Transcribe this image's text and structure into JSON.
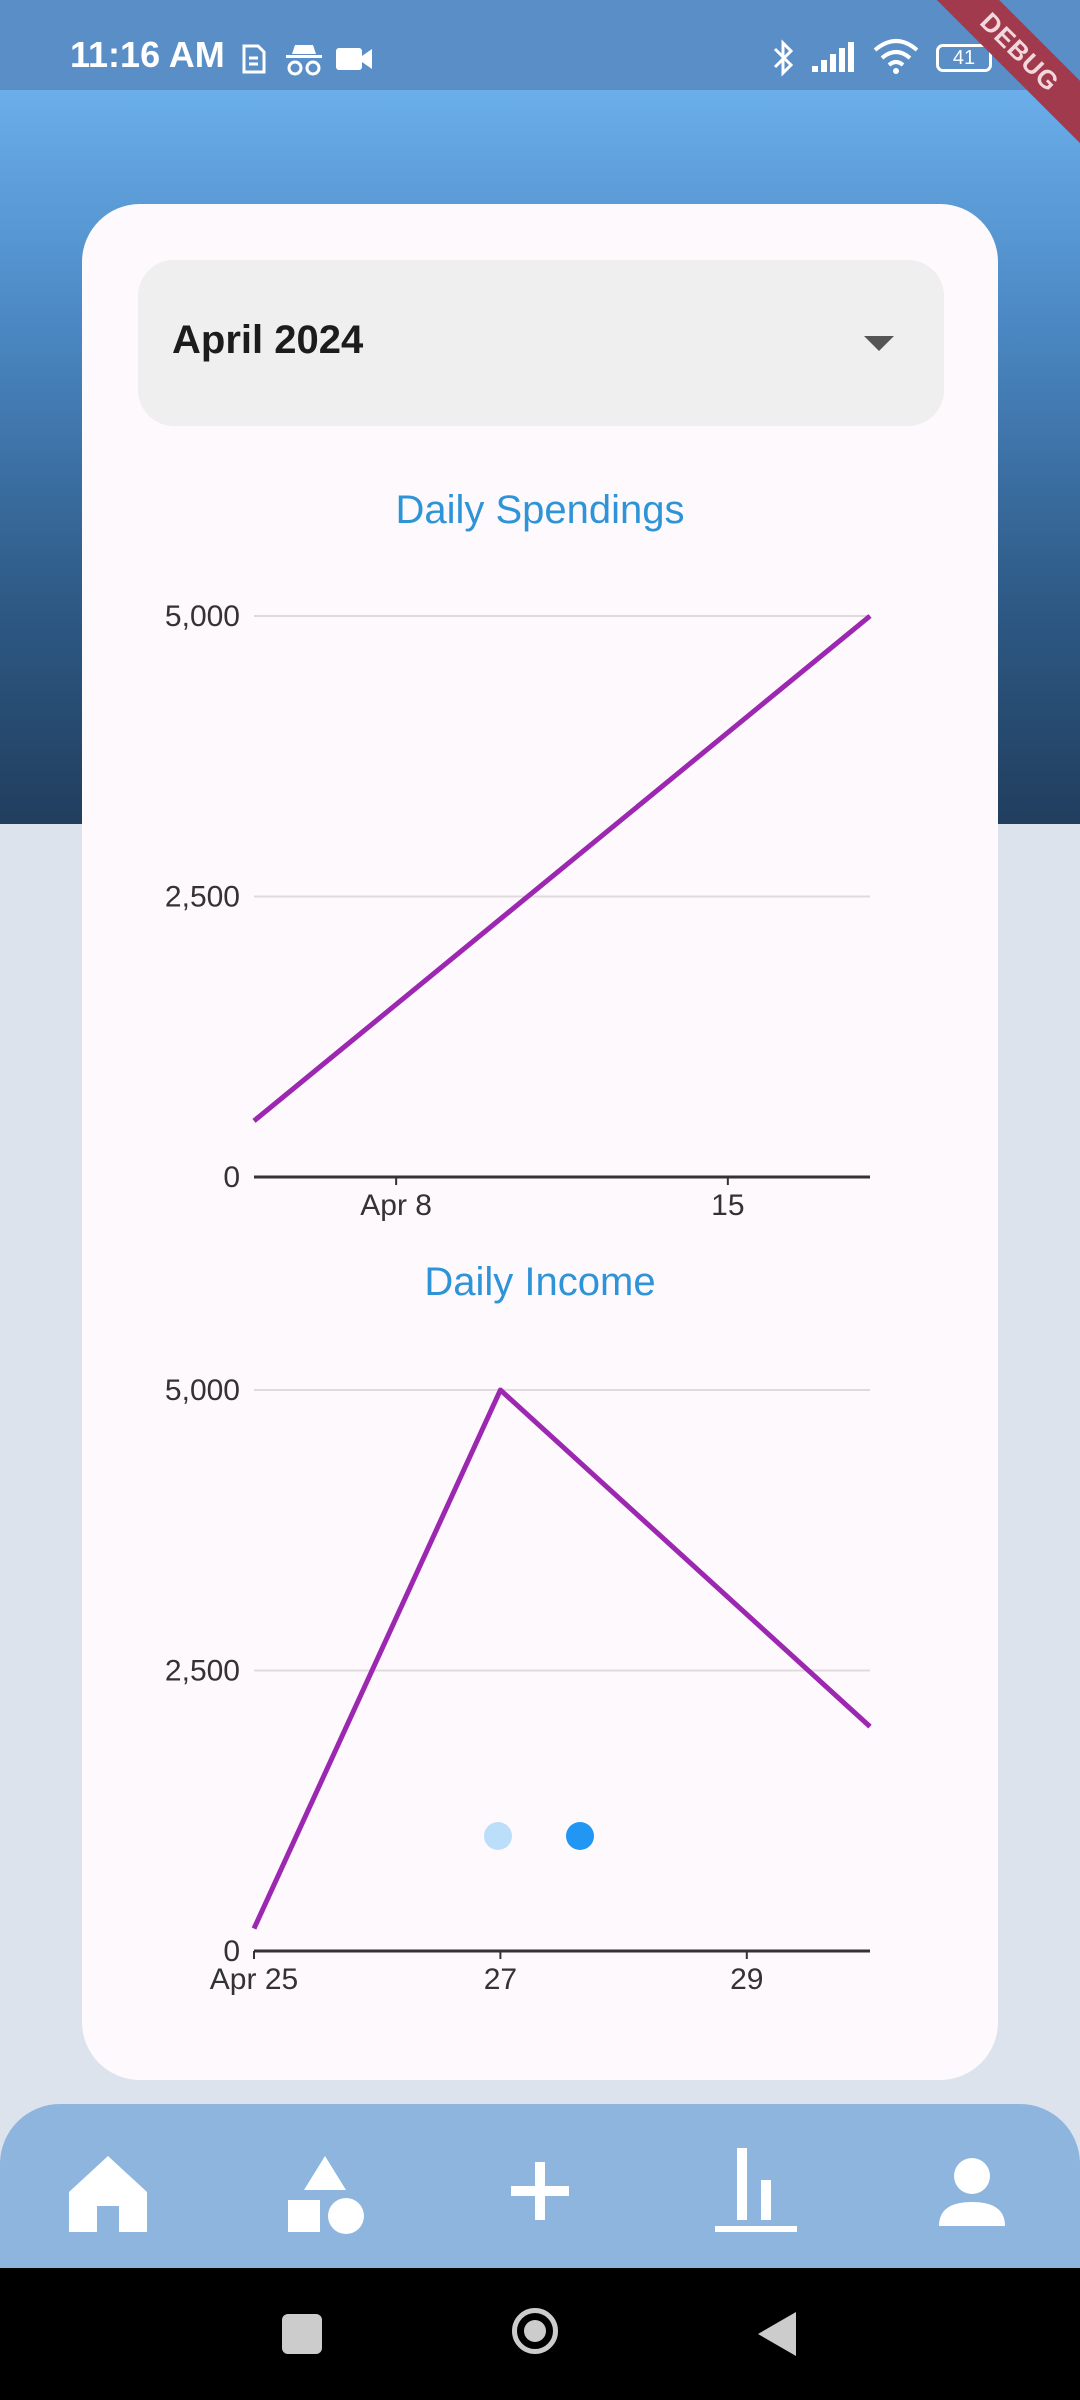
{
  "status_bar": {
    "time": "11:16 AM",
    "battery": "41",
    "debug_banner": "DEBUG",
    "icons": [
      "sim-icon",
      "incognito-icon",
      "video-icon",
      "bluetooth-icon",
      "signal-icon",
      "wifi-icon",
      "battery-icon"
    ]
  },
  "month_selector": {
    "value": "April 2024",
    "icon": "caret-down-icon"
  },
  "pager": {
    "count": 2,
    "active": 1,
    "colors": {
      "active": "#2196f3",
      "inactive": "#bbdefb"
    }
  },
  "colors": {
    "line": "#9c27b0",
    "title": "#2e94d8",
    "grid": "#e0dadd",
    "axis": "#333333"
  },
  "chart_data": [
    {
      "type": "line",
      "title": "Daily Spendings",
      "x_tick_labels": [
        "Apr 8",
        "15"
      ],
      "y_tick_labels": [
        "0",
        "2,500",
        "5,000"
      ],
      "x": [
        "Apr 5",
        "Apr 18"
      ],
      "series": [
        {
          "values": [
            500,
            5000
          ]
        }
      ],
      "ylim": [
        0,
        5000
      ],
      "grid": "horizontal"
    },
    {
      "type": "line",
      "title": "Daily Income",
      "x_tick_labels": [
        "Apr 25",
        "27",
        "29"
      ],
      "y_tick_labels": [
        "0",
        "2,500",
        "5,000"
      ],
      "x": [
        "Apr 25",
        "Apr 27",
        "Apr 30"
      ],
      "series": [
        {
          "values": [
            200,
            5000,
            2000
          ]
        }
      ],
      "ylim": [
        0,
        5000
      ],
      "grid": "horizontal"
    }
  ],
  "bottom_nav": {
    "items": [
      "home-icon",
      "categories-icon",
      "add-icon",
      "stats-icon",
      "profile-icon"
    ],
    "active": 3
  },
  "system_nav": [
    "recents-icon",
    "home-circle-icon",
    "back-icon"
  ]
}
